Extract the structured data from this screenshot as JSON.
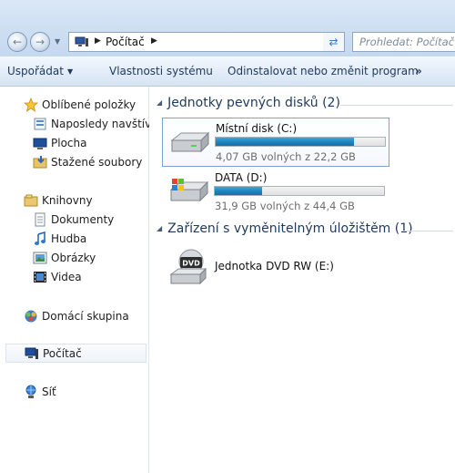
{
  "address": {
    "location": "Počítač",
    "search_placeholder": "Prohledat: Počítač"
  },
  "toolbar": {
    "organize": "Uspořádat",
    "system_properties": "Vlastnosti systému",
    "uninstall": "Odinstalovat nebo změnit program",
    "more": "»"
  },
  "sidebar": {
    "favorites": "Oblíbené položky",
    "recent": "Naposledy navštíver",
    "desktop": "Plocha",
    "downloads": "Stažené soubory",
    "libraries": "Knihovny",
    "documents": "Dokumenty",
    "music": "Hudba",
    "pictures": "Obrázky",
    "videos": "Videa",
    "homegroup": "Domácí skupina",
    "computer": "Počítač",
    "network": "Síť"
  },
  "groups": {
    "hard_disks": "Jednotky pevných disků (2)",
    "removable": "Zařízení s vyměnitelným úložištěm (1)"
  },
  "drives": [
    {
      "name": "Místní disk (C:)",
      "info": "4,07 GB volných z 22,2 GB",
      "used_fraction": 0.817
    },
    {
      "name": "DATA (D:)",
      "info": "31,9 GB volných z 44,4 GB",
      "used_fraction": 0.282
    }
  ],
  "dvd": {
    "name": "Jednotka DVD RW (E:)",
    "icon_label": "DVD"
  },
  "colors": {
    "accent": "#1e395b",
    "bar_fill": "#1f86be"
  }
}
